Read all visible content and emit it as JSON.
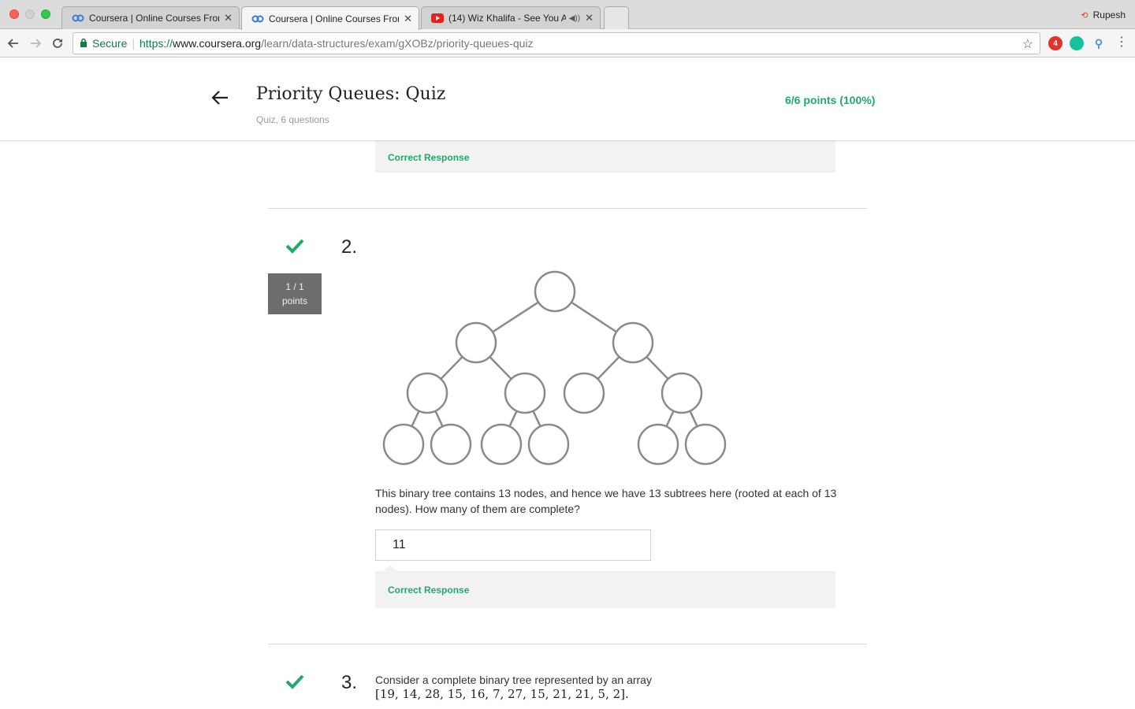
{
  "browser": {
    "tabs": [
      {
        "title": "Coursera | Online Courses From",
        "favicon": "coursera-icon",
        "active": false
      },
      {
        "title": "Coursera | Online Courses From",
        "favicon": "coursera-icon",
        "active": true
      },
      {
        "title": "(14) Wiz Khalifa - See You A",
        "favicon": "youtube-icon",
        "active": false,
        "audio": true
      }
    ],
    "profile_name": "Rupesh",
    "secure_label": "Secure",
    "url_protocol": "https://",
    "url_host": "www.coursera.org",
    "url_path": "/learn/data-structures/exam/gXOBz/priority-queues-quiz",
    "extension_badge": "4"
  },
  "header": {
    "title": "Priority Queues: Quiz",
    "subtitle": "Quiz, 6 questions",
    "score": "6/6 points (100%)"
  },
  "question1": {
    "feedback": "Correct Response"
  },
  "question2": {
    "number": "2.",
    "points_line1": "1 / 1",
    "points_line2": "points",
    "text": "This binary tree contains 13 nodes, and hence we have 13 subtrees here (rooted at each of 13 nodes). How many of them are complete?",
    "answer": "11",
    "feedback": "Correct Response"
  },
  "question3": {
    "number": "3.",
    "text": "Consider a complete binary tree represented by an array",
    "array": "[19, 14, 28, 15, 16, 7, 27, 15, 21, 21, 5, 2]."
  },
  "colors": {
    "success": "#1eaa6a",
    "points_box": "#6d6d6d",
    "feedback_bg": "#f2f2f2"
  }
}
